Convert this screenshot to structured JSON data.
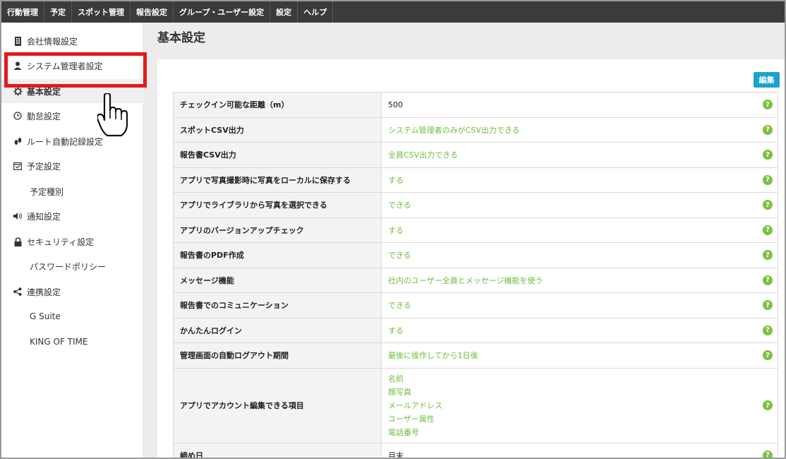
{
  "topnav": {
    "items": [
      "行動管理",
      "予定",
      "スポット管理",
      "報告設定",
      "グループ・ユーザー設定",
      "設定",
      "ヘルプ"
    ]
  },
  "sidebar": {
    "items": [
      {
        "label": "会社情報設定",
        "icon": "building-icon"
      },
      {
        "label": "システム管理者設定",
        "icon": "user-icon"
      },
      {
        "label": "基本設定",
        "icon": "gear-icon",
        "active": true
      },
      {
        "label": "勤怠設定",
        "icon": "clock-icon"
      },
      {
        "label": "ルート自動記録設定",
        "icon": "footsteps-icon"
      },
      {
        "label": "予定設定",
        "icon": "calendar-check-icon"
      },
      {
        "label": "予定種別",
        "sub": true
      },
      {
        "label": "通知設定",
        "icon": "speaker-icon"
      },
      {
        "label": "セキュリティ設定",
        "icon": "lock-icon"
      },
      {
        "label": "パスワードポリシー",
        "sub": true
      },
      {
        "label": "連携設定",
        "icon": "share-icon"
      },
      {
        "label": "G Suite",
        "sub": true
      },
      {
        "label": "KING OF TIME",
        "sub": true
      }
    ]
  },
  "main": {
    "title": "基本設定",
    "edit_label": "編集",
    "help_glyph": "?",
    "rows": [
      {
        "key": "チェックイン可能な距離（m）",
        "value": "500",
        "plain": true
      },
      {
        "key": "スポットCSV出力",
        "value": "システム管理者のみがCSV出力できる"
      },
      {
        "key": "報告書CSV出力",
        "value": "全員CSV出力できる"
      },
      {
        "key": "アプリで写真撮影時に写真をローカルに保存する",
        "value": "する"
      },
      {
        "key": "アプリでライブラリから写真を選択できる",
        "value": "できる"
      },
      {
        "key": "アプリのバージョンアップチェック",
        "value": "する"
      },
      {
        "key": "報告書のPDF作成",
        "value": "できる"
      },
      {
        "key": "メッセージ機能",
        "value": "社内のユーザー全員とメッセージ機能を使う"
      },
      {
        "key": "報告書でのコミュニケーション",
        "value": "できる"
      },
      {
        "key": "かんたんログイン",
        "value": "する"
      },
      {
        "key": "管理画面の自動ログアウト期間",
        "value": "最後に操作してから1日後"
      },
      {
        "key": "アプリでアカウント編集できる項目",
        "values": [
          "名前",
          "顔写真",
          "メールアドレス",
          "ユーザー属性",
          "電話番号"
        ]
      },
      {
        "key": "締め日",
        "value": "月末",
        "plain": true
      }
    ]
  },
  "colors": {
    "accent": "#1aa3cc",
    "value_green": "#6fbf3f",
    "help_green": "#7cc242",
    "highlight_red": "#e21a1a",
    "nav_bg": "#3b3b3b"
  }
}
